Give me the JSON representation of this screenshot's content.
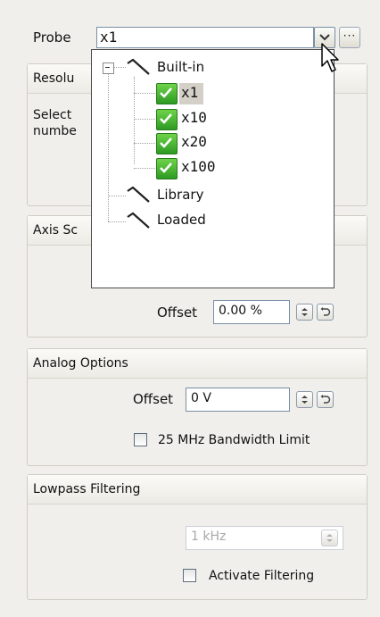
{
  "probe": {
    "label": "Probe",
    "value": "x1",
    "more_label": "···"
  },
  "probe_popup": {
    "root_label": "Built-in",
    "items": [
      "x1",
      "x10",
      "x20",
      "x100"
    ],
    "selected_item": "x1",
    "other_roots": [
      "Library",
      "Loaded"
    ]
  },
  "resolution": {
    "header_partial": "Resolu",
    "body_line1": "Select",
    "body_line2": "numbe"
  },
  "axis_scale": {
    "header_partial": "Axis Sc",
    "offset_label": "Offset",
    "offset_value": "0.00 %"
  },
  "analog_options": {
    "header": "Analog Options",
    "offset_label": "Offset",
    "offset_value": "0 V",
    "bandwidth_label": "25 MHz Bandwidth Limit"
  },
  "lowpass": {
    "header": "Lowpass Filtering",
    "frequency_value": "1 kHz",
    "activate_label": "Activate Filtering"
  }
}
